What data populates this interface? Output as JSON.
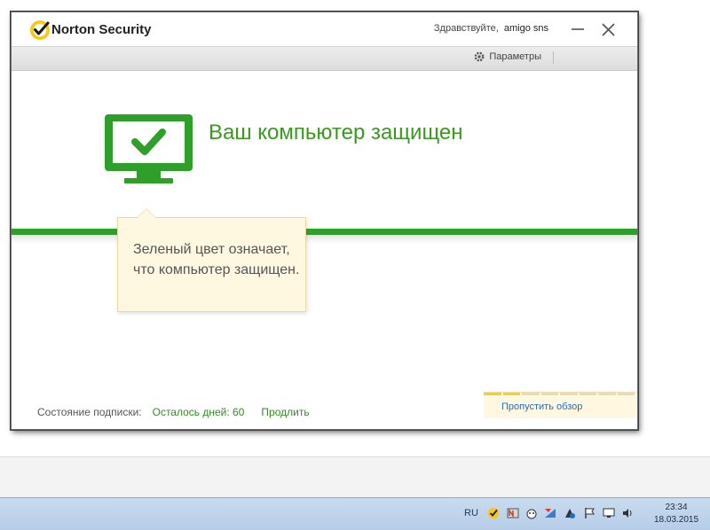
{
  "app": {
    "title": "Norton Security",
    "greeting_prefix": "Здравствуйте,",
    "username": "amigo sns"
  },
  "toolbar": {
    "settings_label": "Параметры"
  },
  "status": {
    "title": "Ваш компьютер защищен",
    "color": "#2ea02a"
  },
  "tooltip": {
    "text": "Зеленый цвет означает, что компьютер защищен."
  },
  "subscription": {
    "label": "Состояние подписки:",
    "days_left": "Осталось дней: 60",
    "renew_label": "Продлить"
  },
  "tour": {
    "skip_label": "Пропустить обзор",
    "steps_total": 8,
    "step_current": 2
  },
  "taskbar": {
    "language": "RU",
    "time": "23:34",
    "date": "18.03.2015",
    "tray_icons": [
      "norton-icon",
      "nx-icon",
      "helper-icon",
      "network-icon",
      "unknown-tray-icon",
      "action-center-flag-icon",
      "display-icon",
      "volume-icon"
    ]
  }
}
